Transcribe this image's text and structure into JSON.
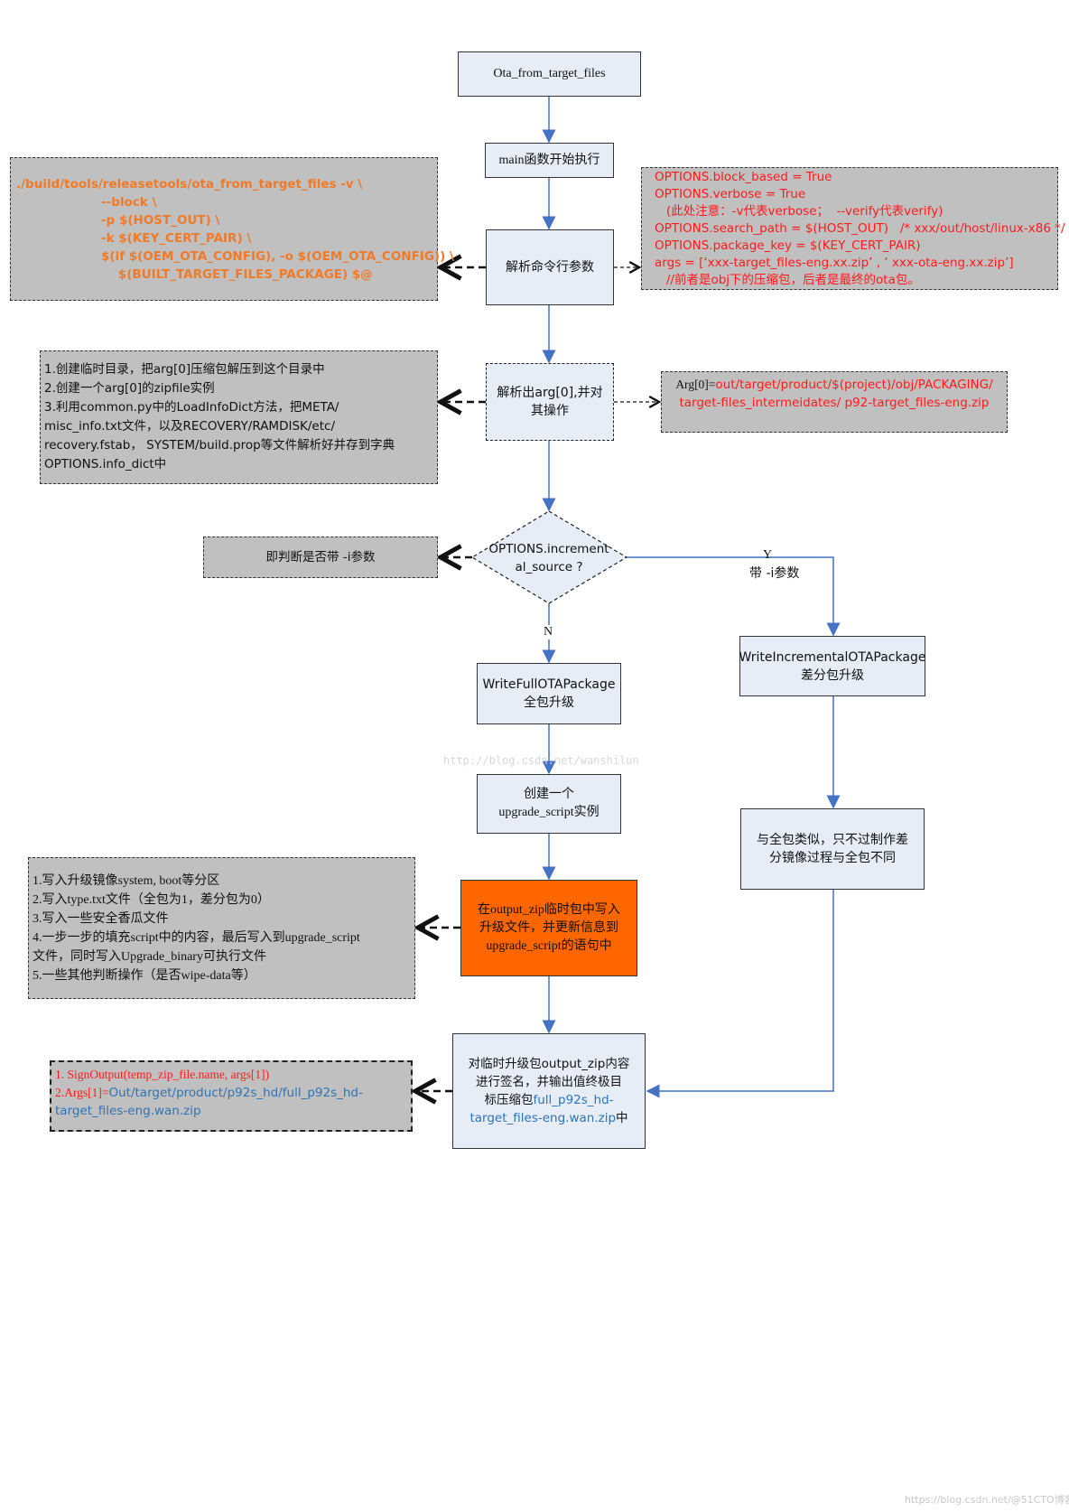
{
  "nodes": {
    "start": "Ota_from_target_files",
    "main": "main函数开始执行",
    "parse_args": "解析命令行参数",
    "parse_arg0": [
      "解析出arg[0],并对",
      "其操作"
    ],
    "decision": [
      "OPTIONS.increment",
      "al_source ?"
    ],
    "write_full": [
      "WriteFullOTAPackage",
      "全包升级"
    ],
    "write_incremental": [
      "WriteIncrementalOTAPackage",
      "差分包升级"
    ],
    "create_script": [
      "创建一个",
      "upgrade_script实例"
    ],
    "similar": [
      "与全包类似，只不过制作差",
      "分镜像过程与全包不同"
    ],
    "write_zip": [
      "在output_zip临时包中写入",
      "升级文件，并更新信息到",
      "upgrade_script的语句中"
    ],
    "sign": {
      "line1": "对临时升级包output_zip内容",
      "line2": "进行签名，并输出值终极目",
      "line3_prefix": "标压缩包",
      "line3_blue": "full_p92s_hd-",
      "line4_blue": "target_files-eng.wan.zip",
      "line4_suffix": "中"
    }
  },
  "notes": {
    "command": [
      "./build/tools/releasetools/ota_from_target_files -v \\",
      "                    --block \\",
      "                    -p $(HOST_OUT) \\",
      "                    -k $(KEY_CERT_PAIR) \\",
      "                    $(if $(OEM_OTA_CONFIG), -o $(OEM_OTA_CONFIG)) \\",
      "                        $(BUILT_TARGET_FILES_PACKAGE) $@"
    ],
    "options": [
      "OPTIONS.block_based = True",
      "OPTIONS.verbose = True",
      "   (此处注意：-v代表verbose；  --verify代表verify)",
      "OPTIONS.search_path = $(HOST_OUT)   /* xxx/out/host/linux-x86 */",
      "OPTIONS.package_key = $(KEY_CERT_PAIR)",
      "args = [‘xxx-target_files-eng.xx.zip’ , ’ xxx-ota-eng.xx.zip’]",
      "   //前者是obj下的压缩包，后者是最终的ota包。"
    ],
    "arg0_steps": [
      "1.创建临时目录，把arg[0]压缩包解压到这个目录中",
      "2.创建一个arg[0]的zipfile实例",
      "3.利用common.py中的LoadInfoDict方法，把META/",
      "misc_info.txt文件，以及RECOVERY/RAMDISK/etc/",
      "recovery.fstab， SYSTEM/build.prop等文件解析好并存到字典",
      "OPTIONS.info_dict中"
    ],
    "arg0_path": {
      "prefix": "Arg[0]=",
      "line1": "out/target/product/$(project)/obj/PACKAGING/",
      "line2": "target-files_intermeidates/ p92-target_files-eng.zip"
    },
    "check_i": "即判断是否带 -i参数",
    "write_steps": [
      "1.写入升级镜像system, boot等分区",
      "2.写入type.txt文件（全包为1，差分包为0）",
      "3.写入一些安全香瓜文件",
      "4.一步一步的填充script中的内容，最后写入到upgrade_script",
      "文件，同时写入Upgrade_binary可执行文件",
      "5.一些其他判断操作（是否wipe-data等）"
    ],
    "sign_steps": {
      "line1": "1. SignOutput(temp_zip_file.name, args[1])",
      "line2_prefix": "2.Args[1]=",
      "line2_blue": "Out/target/product/p92s_hd/full_p92s_hd-",
      "line3_blue": "target_files-eng.wan.zip"
    }
  },
  "edges": {
    "yes_label": "Y",
    "yes_sub": "带 -i参数",
    "no_label": "N"
  },
  "watermarks": {
    "center": "http://blog.csdn.net/wanshilun",
    "corner": "https://blog.csdn.net/@51CTO博客"
  },
  "colors": {
    "arrow": "#4472c4",
    "note_bg": "#c0c0c0",
    "process_bg": "#e6edf7",
    "highlight": "#ff6600",
    "orange_text": "#f07a28",
    "red_text": "#ff1a1a",
    "blue_text": "#2e74b5"
  }
}
